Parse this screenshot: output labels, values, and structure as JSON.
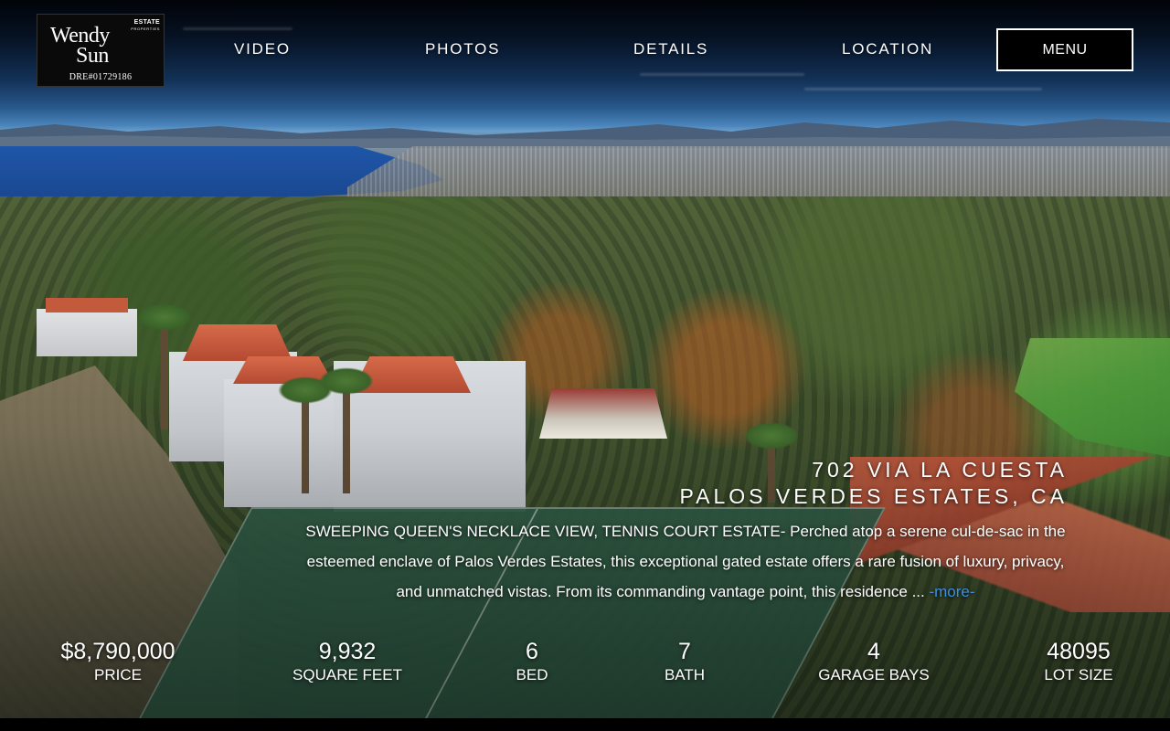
{
  "logo": {
    "name_line1": "Wendy",
    "name_line2": "Sun",
    "badge_main": "ESTATE",
    "badge_sub": "PROPERTIES",
    "license": "DRE#01729186"
  },
  "nav": {
    "video": "VIDEO",
    "photos": "PHOTOS",
    "details": "DETAILS",
    "location": "LOCATION",
    "menu": "MENU"
  },
  "listing": {
    "address_line1": "702 VIA LA CUESTA",
    "address_line2": "PALOS VERDES ESTATES, CA",
    "description": "SWEEPING QUEEN'S NECKLACE VIEW, TENNIS COURT ESTATE- Perched atop a serene cul-de-sac in the esteemed enclave of Palos Verdes Estates, this exceptional gated estate offers a rare fusion of luxury, privacy, and unmatched vistas. From its commanding vantage point, this residence ... ",
    "more_link": "-more-"
  },
  "stats": {
    "price": {
      "value": "$8,790,000",
      "label": "PRICE"
    },
    "square_feet": {
      "value": "9,932",
      "label": "SQUARE FEET"
    },
    "bed": {
      "value": "6",
      "label": "BED"
    },
    "bath": {
      "value": "7",
      "label": "BATH"
    },
    "garage_bays": {
      "value": "4",
      "label": "GARAGE BAYS"
    },
    "lot_size": {
      "value": "48095",
      "label": "LOT SIZE"
    }
  }
}
